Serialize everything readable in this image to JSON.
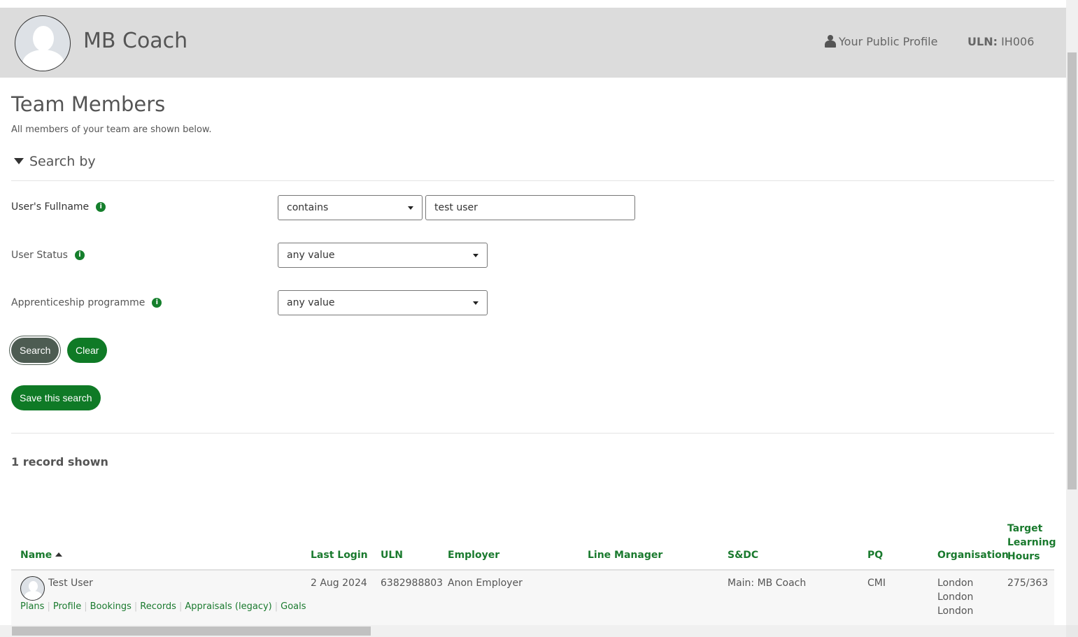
{
  "header": {
    "title": "MB Coach",
    "public_profile": "Your Public Profile",
    "uln_label": "ULN:",
    "uln_value": "IH006"
  },
  "page": {
    "title": "Team Members",
    "subtitle": "All members of your team are shown below.",
    "search_by": "Search by"
  },
  "filters": [
    {
      "label": "User's Fullname",
      "operator": "contains",
      "value": "test user"
    },
    {
      "label": "User Status",
      "value": "any value"
    },
    {
      "label": "Apprenticeship programme",
      "value": "any value"
    }
  ],
  "buttons": {
    "search": "Search",
    "clear": "Clear",
    "save_search": "Save this search"
  },
  "results": {
    "count": "1 record shown"
  },
  "table": {
    "headers": [
      "Name",
      "Last Login",
      "ULN",
      "Employer",
      "Line Manager",
      "S&DC",
      "PQ",
      "Organisation",
      "Target Learning Hours"
    ],
    "rows": [
      {
        "name": "Test User",
        "last_login": "2 Aug 2024",
        "uln": "6382988803",
        "employer": "Anon Employer",
        "line_manager": "",
        "sdc": "Main: MB Coach",
        "pq": "CMI",
        "organisation": [
          "London",
          "London",
          "London"
        ],
        "target_hours": "275/363",
        "links": [
          "Plans",
          "Profile",
          "Bookings",
          "Records",
          "Appraisals (legacy)",
          "Goals"
        ]
      }
    ]
  }
}
